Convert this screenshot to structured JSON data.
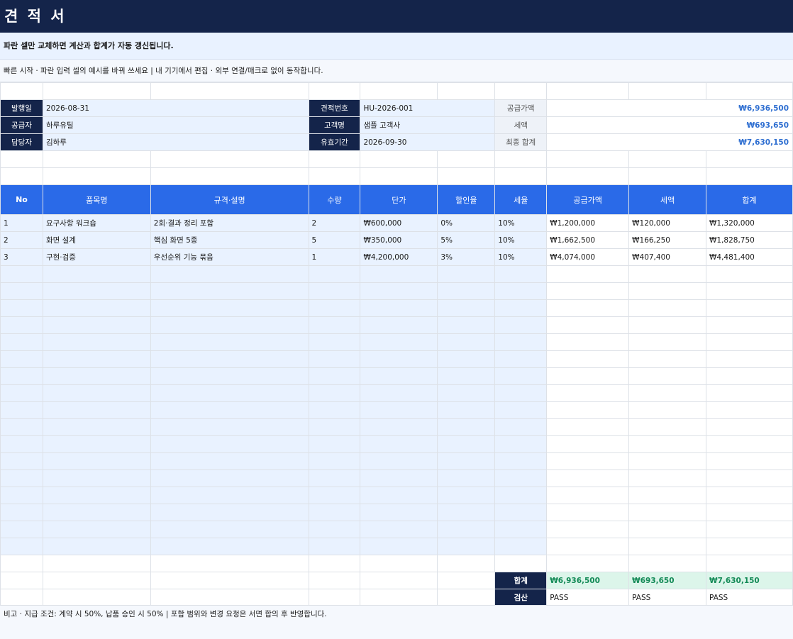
{
  "title": "견 적 서",
  "notice": "파란 셀만 교체하면 계산과 합계가 자동 갱신됩니다.",
  "quick_start": "빠른 시작 · 파란 입력 셀의 예시를 바꿔 쓰세요  |  내 기기에서 편집 · 외부 연결/매크로 없이 동작합니다.",
  "info": {
    "issue_date_label": "발행일",
    "issue_date": "2026-08-31",
    "supplier_label": "공급자",
    "supplier": "하루유틸",
    "manager_label": "담당자",
    "manager": "김하루",
    "quote_no_label": "견적번호",
    "quote_no": "HU-2026-001",
    "customer_label": "고객명",
    "customer": "샘플 고객사",
    "valid_label": "유효기간",
    "valid_until": "2026-09-30"
  },
  "summary": {
    "supply_label": "공급가액",
    "supply": "₩6,936,500",
    "tax_label": "세액",
    "tax": "₩693,650",
    "total_label": "최종 합계",
    "total": "₩7,630,150"
  },
  "columns": [
    "No",
    "품목명",
    "규격·설명",
    "수량",
    "단가",
    "할인율",
    "세율",
    "공급가액",
    "세액",
    "합계"
  ],
  "items": [
    {
      "no": "1",
      "name": "요구사항 워크숍",
      "spec": "2회·결과 정리 포함",
      "qty": "2",
      "price": "₩600,000",
      "discount": "0%",
      "tax_rate": "10%",
      "supply": "₩1,200,000",
      "tax": "₩120,000",
      "total": "₩1,320,000"
    },
    {
      "no": "2",
      "name": "화면 설계",
      "spec": "핵심 화면 5종",
      "qty": "5",
      "price": "₩350,000",
      "discount": "5%",
      "tax_rate": "10%",
      "supply": "₩1,662,500",
      "tax": "₩166,250",
      "total": "₩1,828,750"
    },
    {
      "no": "3",
      "name": "구현·검증",
      "spec": "우선순위 기능 묶음",
      "qty": "1",
      "price": "₩4,200,000",
      "discount": "3%",
      "tax_rate": "10%",
      "supply": "₩4,074,000",
      "tax": "₩407,400",
      "total": "₩4,481,400"
    }
  ],
  "totals": {
    "label": "합계",
    "supply": "₩6,936,500",
    "tax": "₩693,650",
    "total": "₩7,630,150",
    "check_label": "검산",
    "check_supply": "PASS",
    "check_tax": "PASS",
    "check_total": "PASS"
  },
  "footnote": "비고 · 지급 조건: 계약 시 50%, 납품 승인 시 50%  |  포함 범위와 변경 요청은 서면 합의 후 반영합니다.",
  "colors": {
    "title_bg": "#14244a",
    "header_bg": "#2a6ae8",
    "input_bg": "#e9f2ff",
    "accent": "#2f6fd1",
    "total_bg": "#dcf5ea"
  }
}
